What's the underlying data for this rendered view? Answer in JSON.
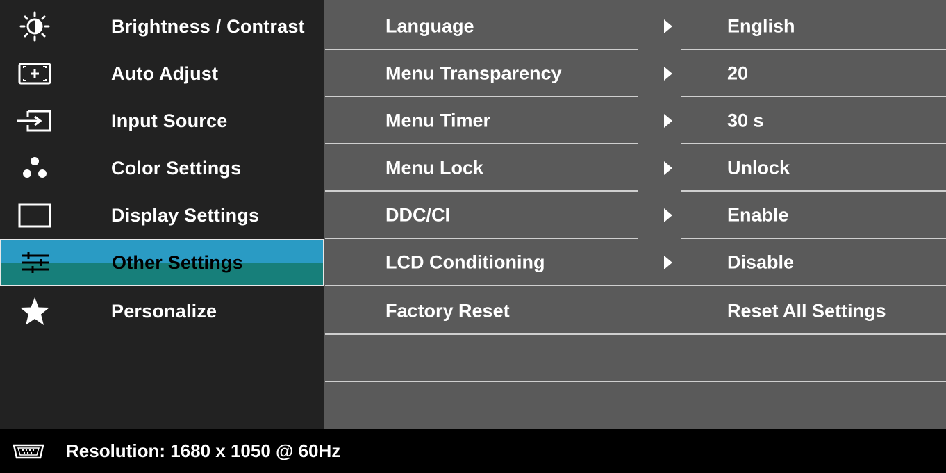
{
  "left_menu": {
    "items": [
      {
        "label": "Brightness / Contrast",
        "icon": "brightness-icon"
      },
      {
        "label": "Auto Adjust",
        "icon": "auto-adjust-icon"
      },
      {
        "label": "Input Source",
        "icon": "input-source-icon"
      },
      {
        "label": "Color Settings",
        "icon": "color-settings-icon"
      },
      {
        "label": "Display Settings",
        "icon": "display-settings-icon"
      },
      {
        "label": "Other Settings",
        "icon": "sliders-icon",
        "selected": true
      },
      {
        "label": "Personalize",
        "icon": "star-icon"
      }
    ]
  },
  "settings": {
    "rows": [
      {
        "name": "Language",
        "value": "English",
        "has_arrow": true
      },
      {
        "name": "Menu Transparency",
        "value": "20",
        "has_arrow": true
      },
      {
        "name": "Menu Timer",
        "value": "30 s",
        "has_arrow": true
      },
      {
        "name": "Menu Lock",
        "value": "Unlock",
        "has_arrow": true
      },
      {
        "name": "DDC/CI",
        "value": "Enable",
        "has_arrow": true
      },
      {
        "name": "LCD Conditioning",
        "value": "Disable",
        "has_arrow": true
      },
      {
        "name": "Factory Reset",
        "value": "Reset All Settings",
        "has_arrow": false
      }
    ]
  },
  "status_bar": {
    "icon": "vga-connector-icon",
    "resolution": "Resolution: 1680 x 1050 @ 60Hz"
  },
  "colors": {
    "selected_top": "#2a9bc4",
    "selected_bottom": "#177f7a",
    "panel_gray": "#5a5a5a",
    "menu_dark": "#222222"
  }
}
